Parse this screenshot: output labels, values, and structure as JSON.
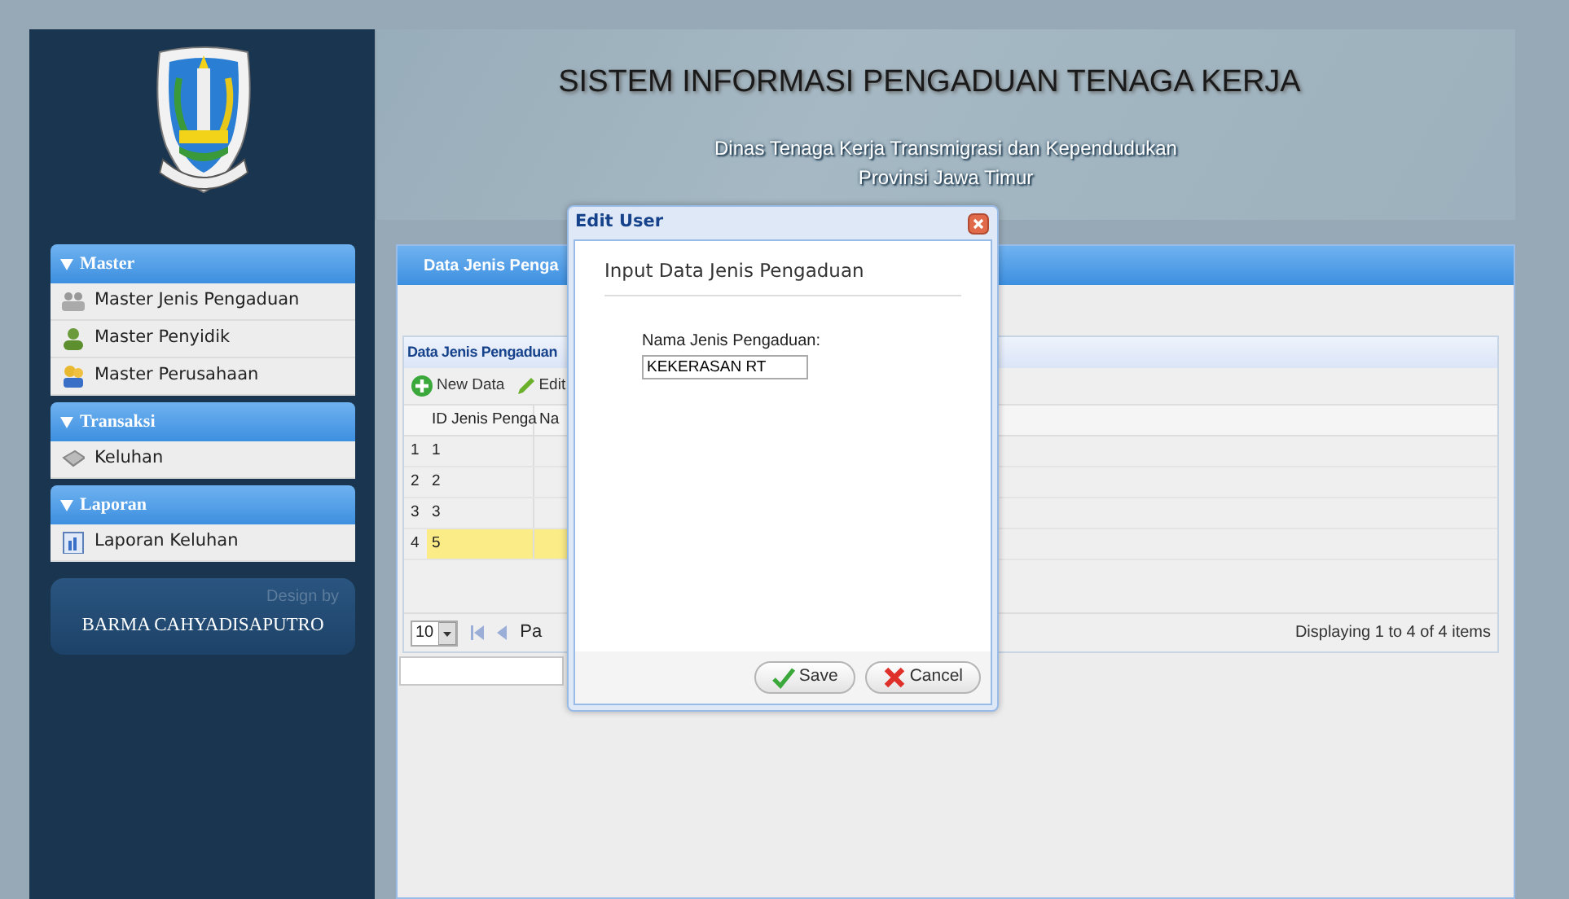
{
  "header": {
    "title": "SISTEM INFORMASI PENGADUAN TENAGA KERJA",
    "subtitle_lines": [
      "Dinas Tenaga Kerja Transmigrasi dan Kependudukan",
      "Provinsi Jawa Timur"
    ]
  },
  "sidebar": {
    "sections": [
      {
        "title": "Master",
        "expanded": true,
        "items": [
          {
            "label": "Master Jenis Pengaduan",
            "kind": "group"
          },
          {
            "label": "Master Penyidik",
            "kind": "person"
          },
          {
            "label": "Master Perusahaan",
            "kind": "company"
          }
        ]
      },
      {
        "title": "Transaksi",
        "expanded": true,
        "items": [
          {
            "label": "Keluhan",
            "kind": "complaint"
          }
        ]
      },
      {
        "title": "Laporan",
        "expanded": true,
        "items": [
          {
            "label": "Laporan Keluhan",
            "kind": "report"
          }
        ]
      }
    ],
    "credit": {
      "caption": "Design by",
      "name": "BARMA CAHYADISAPUTRO"
    }
  },
  "panel": {
    "title": "Data Jenis Penga",
    "grid": {
      "title": "Data Jenis Pengaduan",
      "toolbar": [
        {
          "label": "New Data",
          "kind": "add"
        },
        {
          "label": "Edit",
          "kind": "edit"
        }
      ],
      "columns": [
        "ID Jenis Penga",
        "Na"
      ],
      "rows": [
        {
          "number": "1",
          "id": "1",
          "selected": false
        },
        {
          "number": "2",
          "id": "2",
          "selected": false
        },
        {
          "number": "3",
          "id": "3",
          "selected": false
        },
        {
          "number": "4",
          "id": "5",
          "selected": true
        }
      ],
      "pager": {
        "page_size": "10",
        "page_label": "Pa",
        "summary": "Displaying 1 to 4 of 4 items"
      }
    }
  },
  "dialog": {
    "title": "Edit User",
    "heading": "Input Data Jenis Pengaduan",
    "field": {
      "label": "Nama Jenis Pengaduan:",
      "value": "KEKERASAN RT"
    },
    "buttons": [
      {
        "label": "Save",
        "kind": "save"
      },
      {
        "label": "Cancel",
        "kind": "cancel"
      }
    ]
  }
}
